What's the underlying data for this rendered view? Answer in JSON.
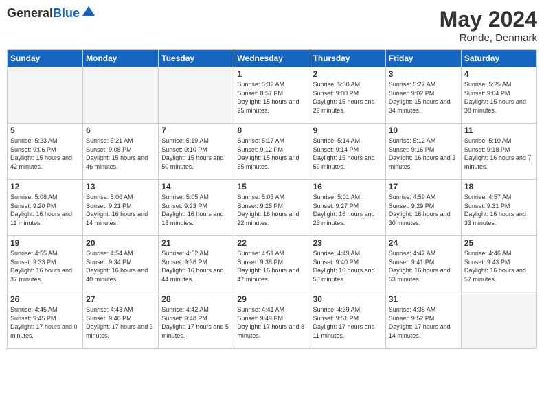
{
  "logo": {
    "general": "General",
    "blue": "Blue"
  },
  "title": {
    "month_year": "May 2024",
    "location": "Ronde, Denmark"
  },
  "headers": [
    "Sunday",
    "Monday",
    "Tuesday",
    "Wednesday",
    "Thursday",
    "Friday",
    "Saturday"
  ],
  "weeks": [
    [
      {
        "day": "",
        "sunrise": "",
        "sunset": "",
        "daylight": "",
        "empty": true
      },
      {
        "day": "",
        "sunrise": "",
        "sunset": "",
        "daylight": "",
        "empty": true
      },
      {
        "day": "",
        "sunrise": "",
        "sunset": "",
        "daylight": "",
        "empty": true
      },
      {
        "day": "1",
        "sunrise": "Sunrise: 5:32 AM",
        "sunset": "Sunset: 8:57 PM",
        "daylight": "Daylight: 15 hours and 25 minutes.",
        "empty": false
      },
      {
        "day": "2",
        "sunrise": "Sunrise: 5:30 AM",
        "sunset": "Sunset: 9:00 PM",
        "daylight": "Daylight: 15 hours and 29 minutes.",
        "empty": false
      },
      {
        "day": "3",
        "sunrise": "Sunrise: 5:27 AM",
        "sunset": "Sunset: 9:02 PM",
        "daylight": "Daylight: 15 hours and 34 minutes.",
        "empty": false
      },
      {
        "day": "4",
        "sunrise": "Sunrise: 5:25 AM",
        "sunset": "Sunset: 9:04 PM",
        "daylight": "Daylight: 15 hours and 38 minutes.",
        "empty": false
      }
    ],
    [
      {
        "day": "5",
        "sunrise": "Sunrise: 5:23 AM",
        "sunset": "Sunset: 9:06 PM",
        "daylight": "Daylight: 15 hours and 42 minutes.",
        "empty": false
      },
      {
        "day": "6",
        "sunrise": "Sunrise: 5:21 AM",
        "sunset": "Sunset: 9:08 PM",
        "daylight": "Daylight: 15 hours and 46 minutes.",
        "empty": false
      },
      {
        "day": "7",
        "sunrise": "Sunrise: 5:19 AM",
        "sunset": "Sunset: 9:10 PM",
        "daylight": "Daylight: 15 hours and 50 minutes.",
        "empty": false
      },
      {
        "day": "8",
        "sunrise": "Sunrise: 5:17 AM",
        "sunset": "Sunset: 9:12 PM",
        "daylight": "Daylight: 15 hours and 55 minutes.",
        "empty": false
      },
      {
        "day": "9",
        "sunrise": "Sunrise: 5:14 AM",
        "sunset": "Sunset: 9:14 PM",
        "daylight": "Daylight: 15 hours and 59 minutes.",
        "empty": false
      },
      {
        "day": "10",
        "sunrise": "Sunrise: 5:12 AM",
        "sunset": "Sunset: 9:16 PM",
        "daylight": "Daylight: 16 hours and 3 minutes.",
        "empty": false
      },
      {
        "day": "11",
        "sunrise": "Sunrise: 5:10 AM",
        "sunset": "Sunset: 9:18 PM",
        "daylight": "Daylight: 16 hours and 7 minutes.",
        "empty": false
      }
    ],
    [
      {
        "day": "12",
        "sunrise": "Sunrise: 5:08 AM",
        "sunset": "Sunset: 9:20 PM",
        "daylight": "Daylight: 16 hours and 11 minutes.",
        "empty": false
      },
      {
        "day": "13",
        "sunrise": "Sunrise: 5:06 AM",
        "sunset": "Sunset: 9:21 PM",
        "daylight": "Daylight: 16 hours and 14 minutes.",
        "empty": false
      },
      {
        "day": "14",
        "sunrise": "Sunrise: 5:05 AM",
        "sunset": "Sunset: 9:23 PM",
        "daylight": "Daylight: 16 hours and 18 minutes.",
        "empty": false
      },
      {
        "day": "15",
        "sunrise": "Sunrise: 5:03 AM",
        "sunset": "Sunset: 9:25 PM",
        "daylight": "Daylight: 16 hours and 22 minutes.",
        "empty": false
      },
      {
        "day": "16",
        "sunrise": "Sunrise: 5:01 AM",
        "sunset": "Sunset: 9:27 PM",
        "daylight": "Daylight: 16 hours and 26 minutes.",
        "empty": false
      },
      {
        "day": "17",
        "sunrise": "Sunrise: 4:59 AM",
        "sunset": "Sunset: 9:29 PM",
        "daylight": "Daylight: 16 hours and 30 minutes.",
        "empty": false
      },
      {
        "day": "18",
        "sunrise": "Sunrise: 4:57 AM",
        "sunset": "Sunset: 9:31 PM",
        "daylight": "Daylight: 16 hours and 33 minutes.",
        "empty": false
      }
    ],
    [
      {
        "day": "19",
        "sunrise": "Sunrise: 4:55 AM",
        "sunset": "Sunset: 9:33 PM",
        "daylight": "Daylight: 16 hours and 37 minutes.",
        "empty": false
      },
      {
        "day": "20",
        "sunrise": "Sunrise: 4:54 AM",
        "sunset": "Sunset: 9:34 PM",
        "daylight": "Daylight: 16 hours and 40 minutes.",
        "empty": false
      },
      {
        "day": "21",
        "sunrise": "Sunrise: 4:52 AM",
        "sunset": "Sunset: 9:36 PM",
        "daylight": "Daylight: 16 hours and 44 minutes.",
        "empty": false
      },
      {
        "day": "22",
        "sunrise": "Sunrise: 4:51 AM",
        "sunset": "Sunset: 9:38 PM",
        "daylight": "Daylight: 16 hours and 47 minutes.",
        "empty": false
      },
      {
        "day": "23",
        "sunrise": "Sunrise: 4:49 AM",
        "sunset": "Sunset: 9:40 PM",
        "daylight": "Daylight: 16 hours and 50 minutes.",
        "empty": false
      },
      {
        "day": "24",
        "sunrise": "Sunrise: 4:47 AM",
        "sunset": "Sunset: 9:41 PM",
        "daylight": "Daylight: 16 hours and 53 minutes.",
        "empty": false
      },
      {
        "day": "25",
        "sunrise": "Sunrise: 4:46 AM",
        "sunset": "Sunset: 9:43 PM",
        "daylight": "Daylight: 16 hours and 57 minutes.",
        "empty": false
      }
    ],
    [
      {
        "day": "26",
        "sunrise": "Sunrise: 4:45 AM",
        "sunset": "Sunset: 9:45 PM",
        "daylight": "Daylight: 17 hours and 0 minutes.",
        "empty": false
      },
      {
        "day": "27",
        "sunrise": "Sunrise: 4:43 AM",
        "sunset": "Sunset: 9:46 PM",
        "daylight": "Daylight: 17 hours and 3 minutes.",
        "empty": false
      },
      {
        "day": "28",
        "sunrise": "Sunrise: 4:42 AM",
        "sunset": "Sunset: 9:48 PM",
        "daylight": "Daylight: 17 hours and 5 minutes.",
        "empty": false
      },
      {
        "day": "29",
        "sunrise": "Sunrise: 4:41 AM",
        "sunset": "Sunset: 9:49 PM",
        "daylight": "Daylight: 17 hours and 8 minutes.",
        "empty": false
      },
      {
        "day": "30",
        "sunrise": "Sunrise: 4:39 AM",
        "sunset": "Sunset: 9:51 PM",
        "daylight": "Daylight: 17 hours and 11 minutes.",
        "empty": false
      },
      {
        "day": "31",
        "sunrise": "Sunrise: 4:38 AM",
        "sunset": "Sunset: 9:52 PM",
        "daylight": "Daylight: 17 hours and 14 minutes.",
        "empty": false
      },
      {
        "day": "",
        "sunrise": "",
        "sunset": "",
        "daylight": "",
        "empty": true
      }
    ]
  ]
}
